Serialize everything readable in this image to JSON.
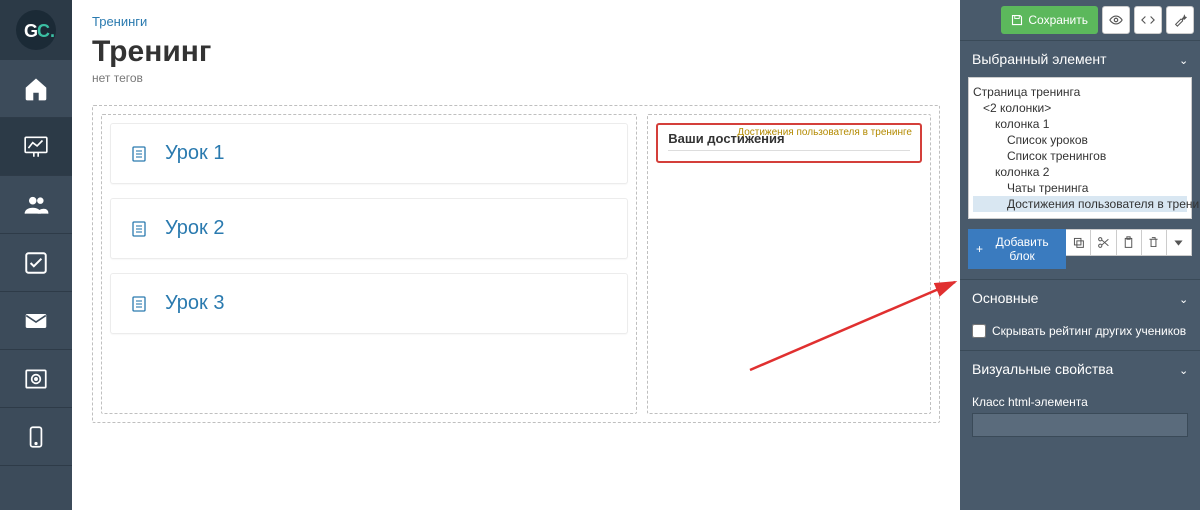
{
  "breadcrumb": "Тренинги",
  "page_title": "Тренинг",
  "no_tags": "нет тегов",
  "lessons": [
    "Урок 1",
    "Урок 2",
    "Урок 3"
  ],
  "achievement": {
    "caption": "Достижения пользователя в тренинге",
    "title": "Ваши достижения"
  },
  "toolbar": {
    "save": "Сохранить"
  },
  "panel": {
    "selected_element": "Выбранный элемент",
    "tree": {
      "root": "Страница тренинга",
      "two_cols": "<2 колонки>",
      "col1": "колонка 1",
      "lessons_list": "Список уроков",
      "trainings_list": "Список тренингов",
      "col2": "колонка 2",
      "chats": "Чаты тренинга",
      "achievements": "Достижения пользователя в тренинг"
    },
    "add_block": "Добавить блок",
    "main_section": "Основные",
    "hide_rating": "Скрывать рейтинг других учеников",
    "visual_section": "Визуальные свойства",
    "html_class_label": "Класс html-элемента"
  }
}
